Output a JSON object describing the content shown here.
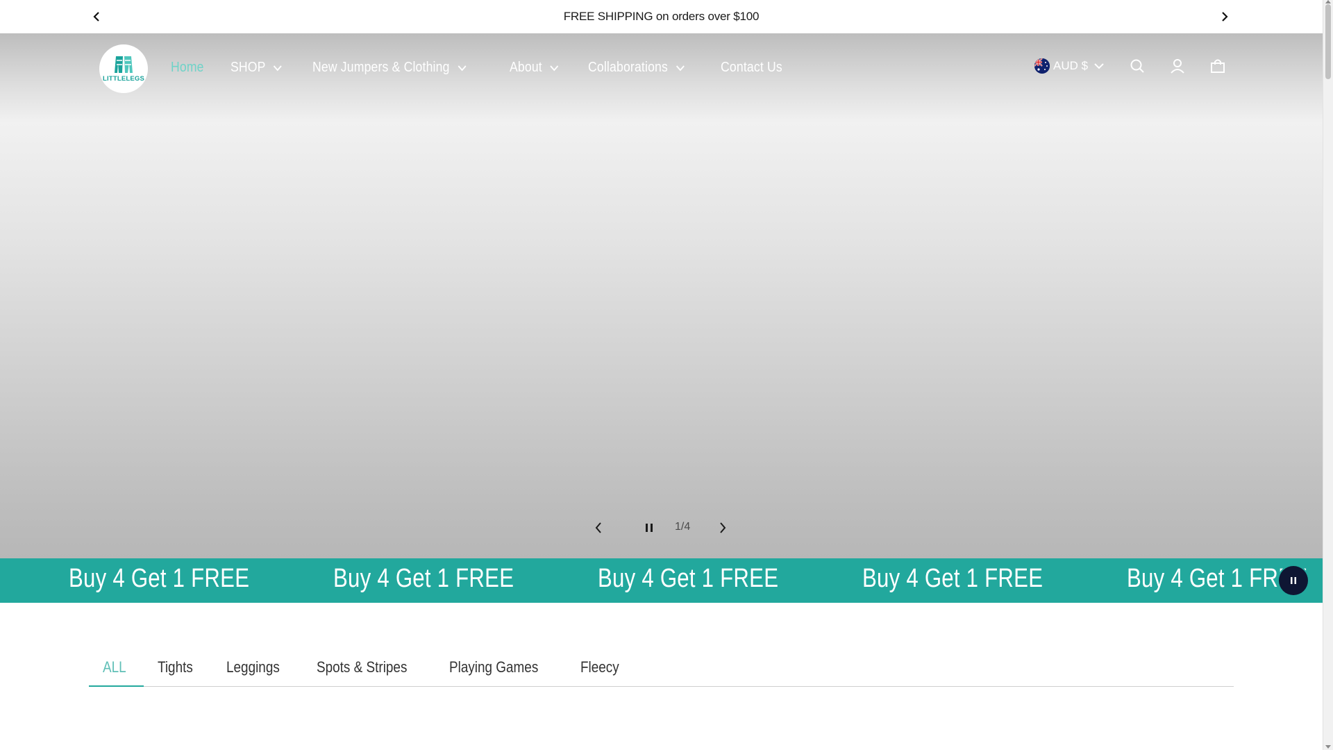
{
  "announcement": {
    "text": "FREE SHIPPING on orders over $100",
    "prev_icon": "chevron-left-icon",
    "next_icon": "chevron-right-icon"
  },
  "header": {
    "logo_text": "LITTLELEGS",
    "nav": [
      {
        "label": "Home",
        "active": true,
        "dropdown": false
      },
      {
        "label": "SHOP",
        "active": false,
        "dropdown": true
      },
      {
        "label": "New Jumpers & Clothing",
        "active": false,
        "dropdown": true
      },
      {
        "label": "About",
        "active": false,
        "dropdown": true
      },
      {
        "label": "Collaborations",
        "active": false,
        "dropdown": true
      },
      {
        "label": "Contact Us",
        "active": false,
        "dropdown": false
      }
    ],
    "currency": "AUD $",
    "icons": [
      "search-icon",
      "account-icon",
      "cart-icon"
    ]
  },
  "slideshow": {
    "counter": "1/4"
  },
  "promo": {
    "text": "Buy 4 Get 1 FREE",
    "color": "#22a89d"
  },
  "tabs": [
    {
      "label": "ALL",
      "active": true
    },
    {
      "label": "Tights",
      "active": false
    },
    {
      "label": "Leggings",
      "active": false
    },
    {
      "label": "Spots & Stripes",
      "active": false
    },
    {
      "label": "Playing Games",
      "active": false
    },
    {
      "label": "Fleecy",
      "active": false
    }
  ],
  "colors": {
    "accent": "#22a89d",
    "active_nav": "#6fd3c8",
    "dark_button": "#0e1633"
  }
}
